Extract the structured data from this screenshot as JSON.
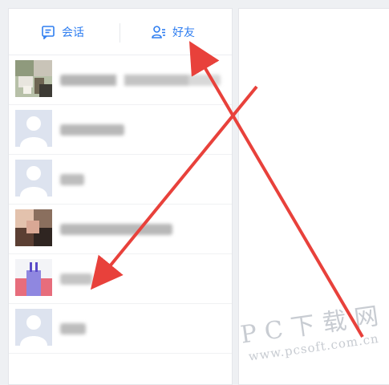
{
  "tabs": {
    "chat_label": "会话",
    "friends_label": "好友"
  },
  "accent_color": "#2f7ef0",
  "annotation_color": "#e8413b",
  "watermark": {
    "main": "PC下载网",
    "url": "www.pcsoft.com.cn"
  },
  "contacts": [
    {
      "avatar": "photo-thumbnail"
    },
    {
      "avatar": "default-silhouette"
    },
    {
      "avatar": "default-silhouette"
    },
    {
      "avatar": "photo-thumbnail"
    },
    {
      "avatar": "candle-image"
    },
    {
      "avatar": "default-silhouette"
    }
  ]
}
